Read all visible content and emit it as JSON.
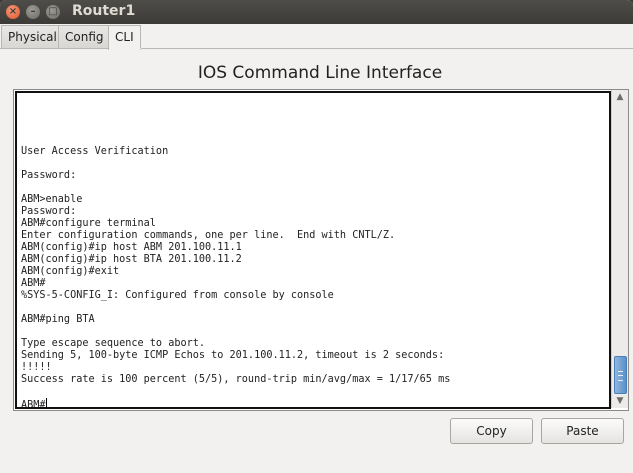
{
  "window": {
    "title": "Router1",
    "controls": {
      "close": "×",
      "minimize": "–",
      "maximize": "□"
    }
  },
  "tabs": [
    {
      "label": "Physical",
      "active": false
    },
    {
      "label": "Config",
      "active": false
    },
    {
      "label": "CLI",
      "active": true
    }
  ],
  "cli": {
    "heading": "IOS Command Line Interface",
    "terminal_text": "User Access Verification\n\nPassword:\n\nABM>enable\nPassword:\nABM#configure terminal\nEnter configuration commands, one per line.  End with CNTL/Z.\nABM(config)#ip host ABM 201.100.11.1\nABM(config)#ip host BTA 201.100.11.2\nABM(config)#exit\nABM#\n%SYS-5-CONFIG_I: Configured from console by console\n\nABM#ping BTA\n\nType escape sequence to abort.\nSending 5, 100-byte ICMP Echos to 201.100.11.2, timeout is 2 seconds:\n!!!!!\nSuccess rate is 100 percent (5/5), round-trip min/avg/max = 1/17/65 ms\n\nABM#",
    "scroll_position": 1.0
  },
  "buttons": {
    "copy": "Copy",
    "paste": "Paste"
  },
  "colors": {
    "titlebar": "#3c3b37",
    "close_button": "#e0532a",
    "scroll_thumb": "#5a8fc9",
    "terminal_background": "#ffffff"
  }
}
